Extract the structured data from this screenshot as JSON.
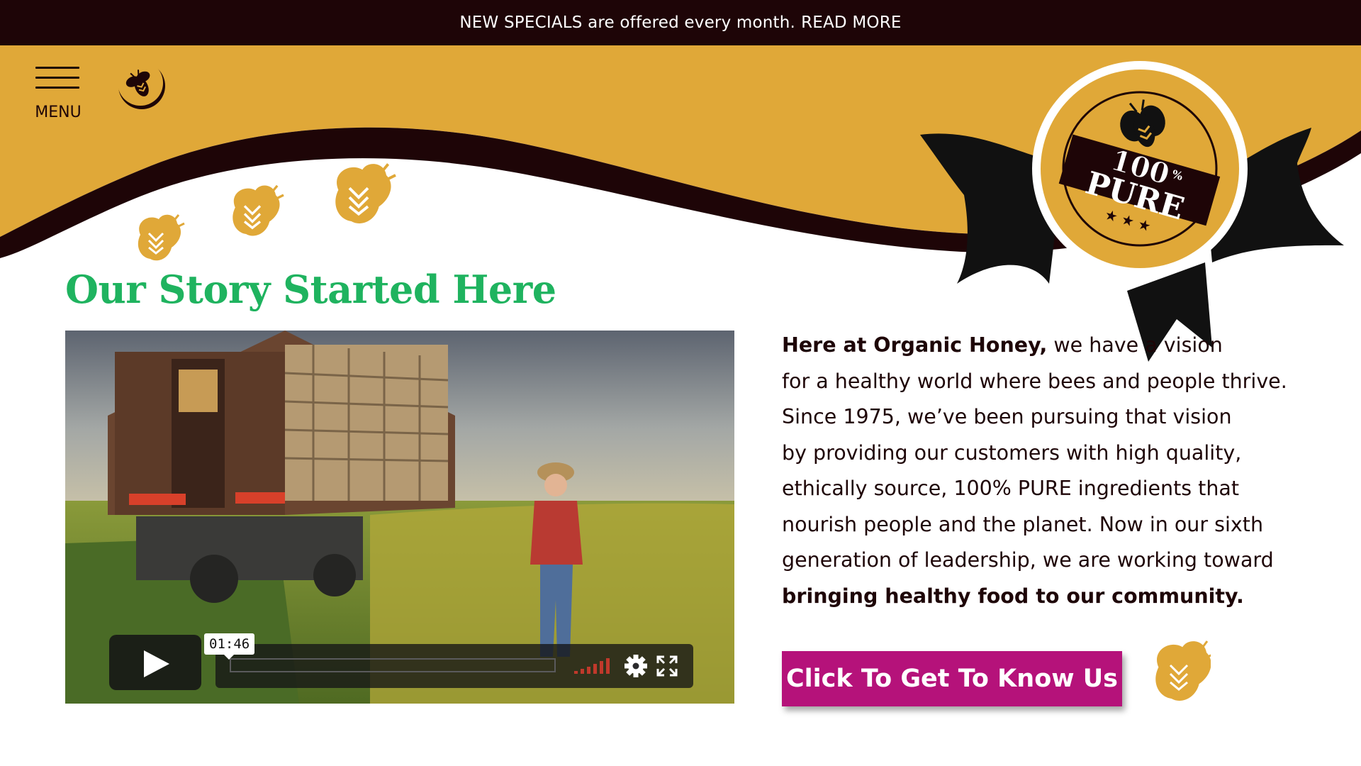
{
  "announcement": {
    "text": "NEW SPECIALS are offered every month.",
    "link": "READ MORE"
  },
  "header": {
    "menu_label": "MENU",
    "logo_icon": "bee-logo-icon"
  },
  "badge": {
    "line1": "100",
    "percent": "%",
    "line2": "PURE"
  },
  "story": {
    "title": "Our Story Started Here"
  },
  "video": {
    "time": "01:46",
    "controls": [
      "play-icon",
      "volume-icon",
      "gear-icon",
      "fullscreen-icon"
    ]
  },
  "intro": {
    "lead_bold": "Here at Organic Honey,",
    "line1_rest": " we have a vision",
    "line2": "for a healthy world where bees and people thrive.",
    "line3": "Since 1975, we’ve been pursuing that vision",
    "line4": "by providing our customers with high quality,",
    "line5": "ethically source, 100% PURE ingredients that",
    "line6": "nourish people and the planet. Now in our sixth",
    "line7": "generation of leadership, we are working toward",
    "closing_bold": "bringing healthy food to our community."
  },
  "cta": {
    "label": "Click To Get To Know Us"
  },
  "colors": {
    "dark_brown": "#1e0507",
    "honey": "#e0a838",
    "green": "#1fb35f",
    "magenta": "#b5127a"
  }
}
